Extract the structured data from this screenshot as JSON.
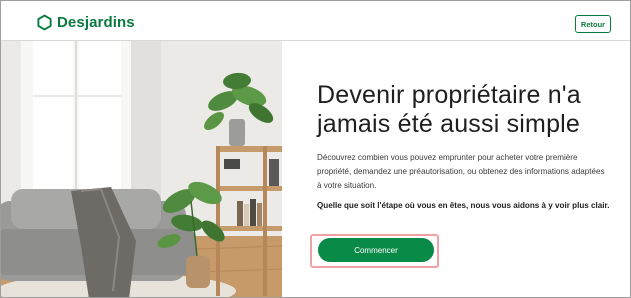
{
  "header": {
    "brand_name": "Desjardins",
    "back_button_label": "Retour",
    "brand_color": "#0a7a3f",
    "logo_icon": "hexagon-logo-icon"
  },
  "hero": {
    "image": "living-room-photo"
  },
  "main": {
    "title_line1": "Devenir propriétaire n'a",
    "title_line2": "jamais été aussi simple",
    "description": "Découvrez combien vous pouvez emprunter pour acheter votre première propriété, demandez une préautorisation, ou obtenez des informations adaptées à votre situation.",
    "statement": "Quelle que soit l'étape où vous en êtes, nous vous aidons à y voir plus clair.",
    "cta_label": "Commencer",
    "cta_color": "#0a8a47",
    "cta_highlight_color": "#f0a3a6"
  }
}
